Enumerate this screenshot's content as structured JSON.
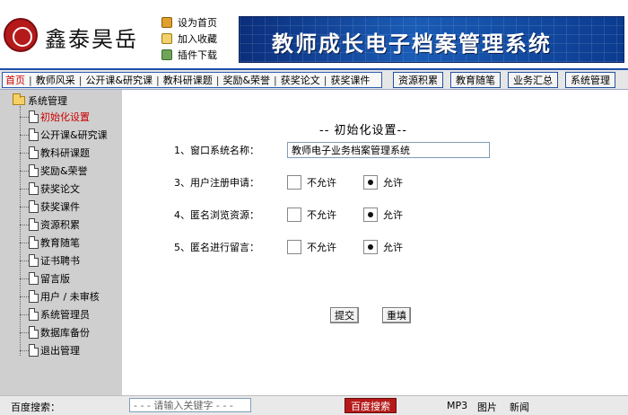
{
  "header": {
    "brand": "鑫泰昊岳",
    "logo_icon": "seal-logo-icon",
    "top_links": [
      {
        "label": "设为首页",
        "icon": "home-icon"
      },
      {
        "label": "加入收藏",
        "icon": "favorite-icon"
      },
      {
        "label": "插件下载",
        "icon": "plugin-icon"
      }
    ],
    "banner_title": "教师成长电子档案管理系统"
  },
  "nav": {
    "left_items": [
      "首页",
      "教师风采",
      "公开课&研究课",
      "教科研课题",
      "奖励&荣誉",
      "获奖论文",
      "获奖课件"
    ],
    "separator": "|",
    "right_buttons": [
      "资源积累",
      "教育随笔",
      "业务汇总",
      "系统管理"
    ],
    "active_color": "#cc0000"
  },
  "sidebar": {
    "root": "系统管理",
    "items": [
      {
        "label": "初始化设置",
        "selected": true
      },
      {
        "label": "公开课&研究课"
      },
      {
        "label": "教科研课题"
      },
      {
        "label": "奖励&荣誉"
      },
      {
        "label": "获奖论文"
      },
      {
        "label": "获奖课件"
      },
      {
        "label": "资源积累"
      },
      {
        "label": "教育随笔"
      },
      {
        "label": "证书聘书"
      },
      {
        "label": "留言版"
      },
      {
        "label": "用户 / 未审核"
      },
      {
        "label": "系统管理员"
      },
      {
        "label": "数据库备份"
      },
      {
        "label": "退出管理"
      }
    ]
  },
  "form": {
    "title": "-- 初始化设置--",
    "name_label": "1、窗口系统名称：",
    "name_value": "教师电子业务档案管理系统",
    "radio_rows": [
      {
        "label": "3、用户注册申请：",
        "opt_no": "不允许",
        "opt_yes": "允许",
        "selected": "yes"
      },
      {
        "label": "4、匿名浏览资源：",
        "opt_no": "不允许",
        "opt_yes": "允许",
        "selected": "yes"
      },
      {
        "label": "5、匿名进行留言：",
        "opt_no": "不允许",
        "opt_yes": "允许",
        "selected": "yes"
      }
    ],
    "submit": "提交",
    "reset": "重填"
  },
  "footer": {
    "label": "百度搜索：",
    "search_placeholder": "- - - 请输入关键字 - - -",
    "search_button": "百度搜索",
    "links": [
      "MP3",
      "图片",
      "新闻"
    ]
  }
}
